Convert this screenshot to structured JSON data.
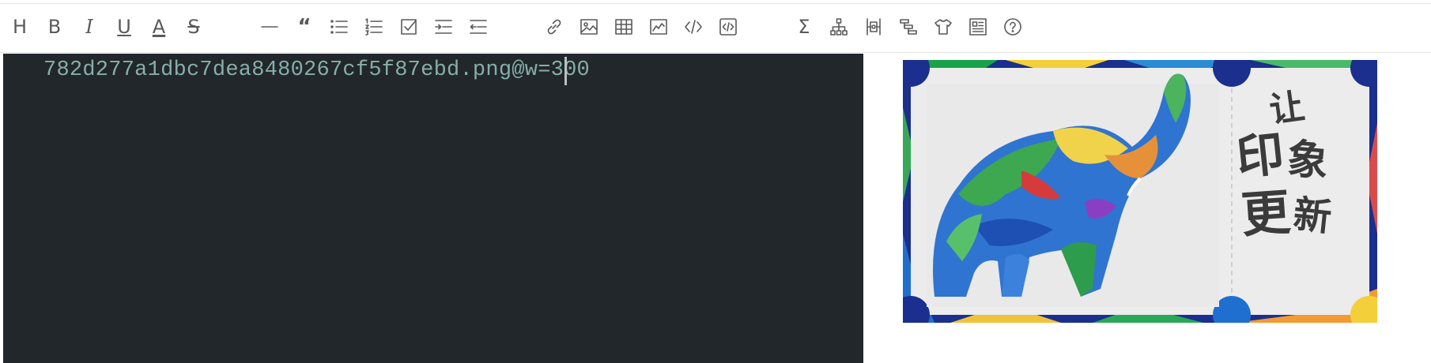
{
  "toolbar": {
    "heading": "H",
    "bold": "B",
    "italic": "I",
    "underline": "U",
    "font_color": "A",
    "strikethrough": "S",
    "quote": "“",
    "formula": "Σ"
  },
  "editor": {
    "line1": "782d277a1dbc7dea8480267cf5f87ebd.png@w=300"
  },
  "preview": {
    "calligraphy_chars": [
      "让",
      "印",
      "象",
      "更",
      "新"
    ]
  },
  "colors": {
    "editor_bg": "#21272b",
    "editor_text": "#87aeaa",
    "icon": "#5a5a5a"
  }
}
